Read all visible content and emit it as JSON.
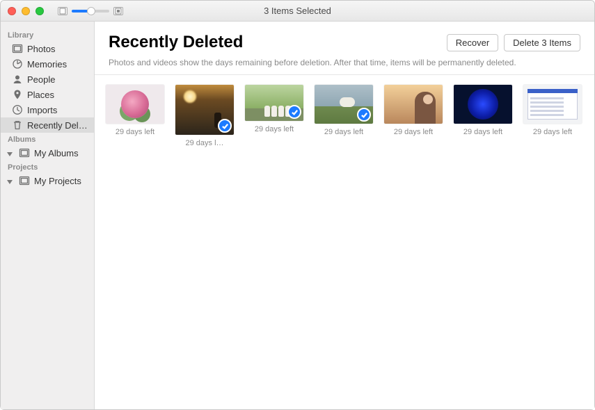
{
  "window": {
    "title": "3 Items Selected"
  },
  "sidebar": {
    "sections": {
      "library": {
        "label": "Library",
        "items": [
          {
            "label": "Photos"
          },
          {
            "label": "Memories"
          },
          {
            "label": "People"
          },
          {
            "label": "Places"
          },
          {
            "label": "Imports"
          },
          {
            "label": "Recently Dele…"
          }
        ]
      },
      "albums": {
        "label": "Albums",
        "items": [
          {
            "label": "My Albums"
          }
        ]
      },
      "projects": {
        "label": "Projects",
        "items": [
          {
            "label": "My Projects"
          }
        ]
      }
    }
  },
  "header": {
    "title": "Recently Deleted",
    "subtitle": "Photos and videos show the days remaining before deletion. After that time, items will be permanently deleted.",
    "buttons": {
      "recover": "Recover",
      "delete": "Delete 3 Items"
    }
  },
  "items": [
    {
      "caption": "29 days left",
      "selected": false
    },
    {
      "caption": "29 days l…",
      "selected": true
    },
    {
      "caption": "29 days left",
      "selected": true
    },
    {
      "caption": "29 days left",
      "selected": true
    },
    {
      "caption": "29 days left",
      "selected": false
    },
    {
      "caption": "29 days left",
      "selected": false
    },
    {
      "caption": "29 days left",
      "selected": false
    }
  ]
}
